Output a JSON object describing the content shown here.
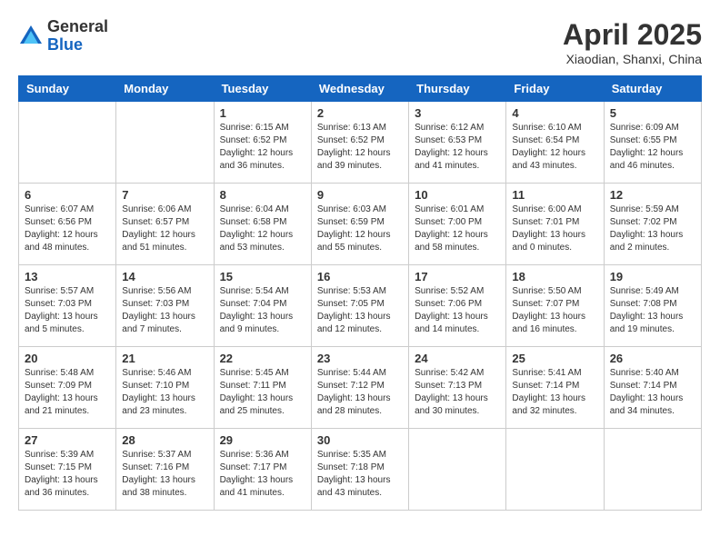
{
  "logo": {
    "general": "General",
    "blue": "Blue"
  },
  "title": "April 2025",
  "location": "Xiaodian, Shanxi, China",
  "days_header": [
    "Sunday",
    "Monday",
    "Tuesday",
    "Wednesday",
    "Thursday",
    "Friday",
    "Saturday"
  ],
  "weeks": [
    [
      {
        "day": "",
        "info": ""
      },
      {
        "day": "",
        "info": ""
      },
      {
        "day": "1",
        "sunrise": "6:15 AM",
        "sunset": "6:52 PM",
        "daylight": "12 hours and 36 minutes."
      },
      {
        "day": "2",
        "sunrise": "6:13 AM",
        "sunset": "6:52 PM",
        "daylight": "12 hours and 39 minutes."
      },
      {
        "day": "3",
        "sunrise": "6:12 AM",
        "sunset": "6:53 PM",
        "daylight": "12 hours and 41 minutes."
      },
      {
        "day": "4",
        "sunrise": "6:10 AM",
        "sunset": "6:54 PM",
        "daylight": "12 hours and 43 minutes."
      },
      {
        "day": "5",
        "sunrise": "6:09 AM",
        "sunset": "6:55 PM",
        "daylight": "12 hours and 46 minutes."
      }
    ],
    [
      {
        "day": "6",
        "sunrise": "6:07 AM",
        "sunset": "6:56 PM",
        "daylight": "12 hours and 48 minutes."
      },
      {
        "day": "7",
        "sunrise": "6:06 AM",
        "sunset": "6:57 PM",
        "daylight": "12 hours and 51 minutes."
      },
      {
        "day": "8",
        "sunrise": "6:04 AM",
        "sunset": "6:58 PM",
        "daylight": "12 hours and 53 minutes."
      },
      {
        "day": "9",
        "sunrise": "6:03 AM",
        "sunset": "6:59 PM",
        "daylight": "12 hours and 55 minutes."
      },
      {
        "day": "10",
        "sunrise": "6:01 AM",
        "sunset": "7:00 PM",
        "daylight": "12 hours and 58 minutes."
      },
      {
        "day": "11",
        "sunrise": "6:00 AM",
        "sunset": "7:01 PM",
        "daylight": "13 hours and 0 minutes."
      },
      {
        "day": "12",
        "sunrise": "5:59 AM",
        "sunset": "7:02 PM",
        "daylight": "13 hours and 2 minutes."
      }
    ],
    [
      {
        "day": "13",
        "sunrise": "5:57 AM",
        "sunset": "7:03 PM",
        "daylight": "13 hours and 5 minutes."
      },
      {
        "day": "14",
        "sunrise": "5:56 AM",
        "sunset": "7:03 PM",
        "daylight": "13 hours and 7 minutes."
      },
      {
        "day": "15",
        "sunrise": "5:54 AM",
        "sunset": "7:04 PM",
        "daylight": "13 hours and 9 minutes."
      },
      {
        "day": "16",
        "sunrise": "5:53 AM",
        "sunset": "7:05 PM",
        "daylight": "13 hours and 12 minutes."
      },
      {
        "day": "17",
        "sunrise": "5:52 AM",
        "sunset": "7:06 PM",
        "daylight": "13 hours and 14 minutes."
      },
      {
        "day": "18",
        "sunrise": "5:50 AM",
        "sunset": "7:07 PM",
        "daylight": "13 hours and 16 minutes."
      },
      {
        "day": "19",
        "sunrise": "5:49 AM",
        "sunset": "7:08 PM",
        "daylight": "13 hours and 19 minutes."
      }
    ],
    [
      {
        "day": "20",
        "sunrise": "5:48 AM",
        "sunset": "7:09 PM",
        "daylight": "13 hours and 21 minutes."
      },
      {
        "day": "21",
        "sunrise": "5:46 AM",
        "sunset": "7:10 PM",
        "daylight": "13 hours and 23 minutes."
      },
      {
        "day": "22",
        "sunrise": "5:45 AM",
        "sunset": "7:11 PM",
        "daylight": "13 hours and 25 minutes."
      },
      {
        "day": "23",
        "sunrise": "5:44 AM",
        "sunset": "7:12 PM",
        "daylight": "13 hours and 28 minutes."
      },
      {
        "day": "24",
        "sunrise": "5:42 AM",
        "sunset": "7:13 PM",
        "daylight": "13 hours and 30 minutes."
      },
      {
        "day": "25",
        "sunrise": "5:41 AM",
        "sunset": "7:14 PM",
        "daylight": "13 hours and 32 minutes."
      },
      {
        "day": "26",
        "sunrise": "5:40 AM",
        "sunset": "7:14 PM",
        "daylight": "13 hours and 34 minutes."
      }
    ],
    [
      {
        "day": "27",
        "sunrise": "5:39 AM",
        "sunset": "7:15 PM",
        "daylight": "13 hours and 36 minutes."
      },
      {
        "day": "28",
        "sunrise": "5:37 AM",
        "sunset": "7:16 PM",
        "daylight": "13 hours and 38 minutes."
      },
      {
        "day": "29",
        "sunrise": "5:36 AM",
        "sunset": "7:17 PM",
        "daylight": "13 hours and 41 minutes."
      },
      {
        "day": "30",
        "sunrise": "5:35 AM",
        "sunset": "7:18 PM",
        "daylight": "13 hours and 43 minutes."
      },
      {
        "day": "",
        "info": ""
      },
      {
        "day": "",
        "info": ""
      },
      {
        "day": "",
        "info": ""
      }
    ]
  ]
}
